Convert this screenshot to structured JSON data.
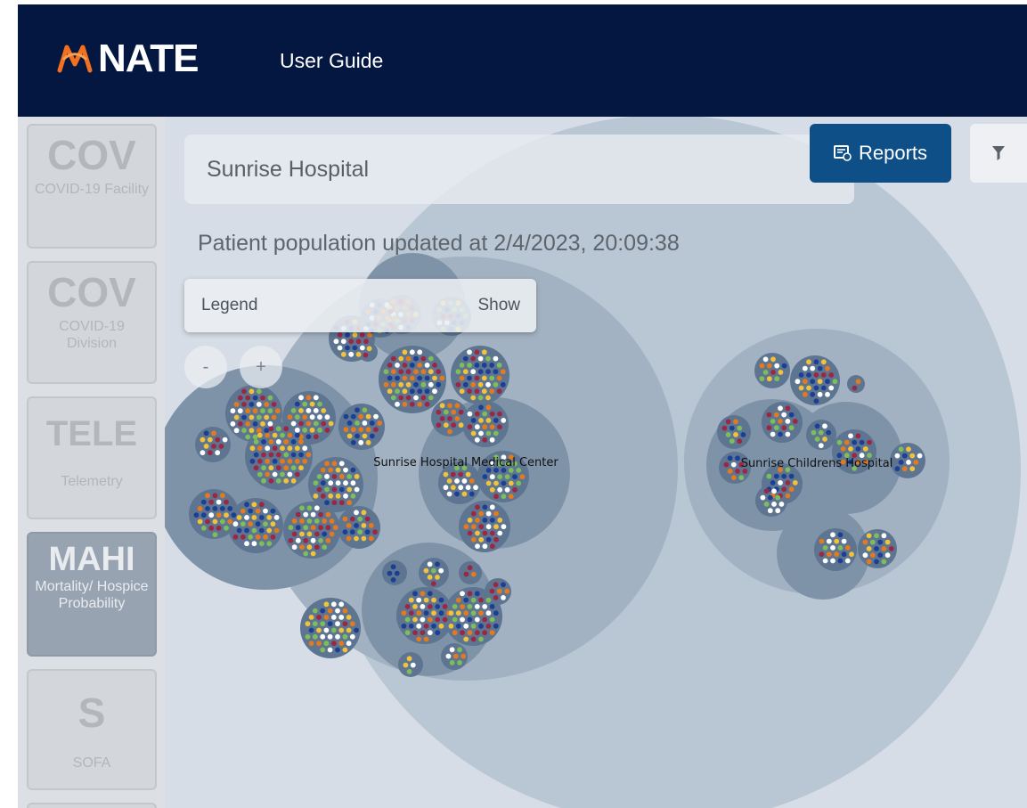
{
  "header": {
    "app_name": "NATE",
    "nav_link": "User Guide",
    "logo_icon": "nate-logo-icon",
    "background_color": "#031741",
    "logo_color": "#f37021"
  },
  "sidebar": {
    "items": [
      {
        "code": "COV",
        "label": "COVID-19 Facility",
        "active": false
      },
      {
        "code": "COV",
        "label": "COVID-19 Division",
        "active": false
      },
      {
        "code": "TELE",
        "label": "Telemetry",
        "active": false
      },
      {
        "code": "MAHI",
        "label": "Mortality/ Hospice Probability",
        "active": true
      },
      {
        "code": "S",
        "label": "SOFA",
        "active": false
      }
    ]
  },
  "main": {
    "hospital_field": {
      "value": "Sunrise Hospital"
    },
    "updated_text": "Patient population updated at 2/4/2023, 20:09:38",
    "legend": {
      "label": "Legend",
      "toggle": "Show"
    },
    "zoom": {
      "minus": "-",
      "plus": "+"
    },
    "reports_button": {
      "label": "Reports",
      "icon": "report-icon"
    },
    "filter_button": {
      "icon": "filter-icon"
    }
  },
  "bubble_chart": {
    "facilities": [
      {
        "name": "Sunrise Hospital Medical Center"
      },
      {
        "name": "Sunrise Childrens Hospital"
      }
    ],
    "patient_status_colors": [
      "#1b3f94",
      "#f2c23a",
      "#7dbd5a",
      "#ffffff",
      "#9c2745",
      "#e4791e"
    ]
  }
}
